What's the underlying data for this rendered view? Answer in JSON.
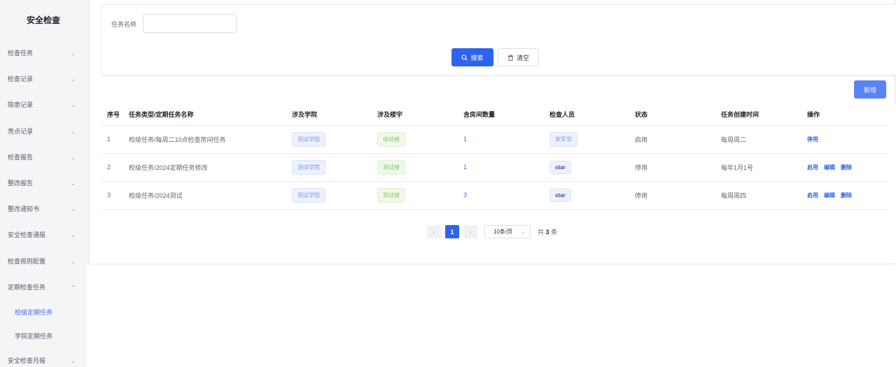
{
  "sidebar": {
    "title": "安全检查",
    "items": [
      {
        "label": "检查任务"
      },
      {
        "label": "检查记录"
      },
      {
        "label": "隐患记录"
      },
      {
        "label": "亮点记录"
      },
      {
        "label": "检查报告"
      },
      {
        "label": "整改报告"
      },
      {
        "label": "整改通知书"
      },
      {
        "label": "安全检查通报"
      },
      {
        "label": "检查规则配置"
      },
      {
        "label": "定期检查任务"
      }
    ],
    "sub_items": [
      {
        "label": "校级定期任务",
        "active": true
      },
      {
        "label": "学院定期任务",
        "active": false
      }
    ],
    "last_item": {
      "label": "安全检查月报"
    }
  },
  "search": {
    "label": "任务名称",
    "value": "",
    "placeholder": "",
    "search_button": "搜索",
    "clear_button": "清空"
  },
  "toolbar": {
    "add_button": "新增"
  },
  "table": {
    "headers": [
      "序号",
      "任务类型/定期任务名称",
      "涉及学院",
      "涉及楼宇",
      "含房间数量",
      "检查人员",
      "状态",
      "任务创建时间",
      "操作"
    ],
    "rows": [
      {
        "index": "1",
        "name": "校级任务/每周二10点检查房间任务",
        "college": "测试学院",
        "building": "体验楼",
        "rooms": "1",
        "inspector": "宋军华",
        "status": "启用",
        "created": "每周周二",
        "ops": [
          "停用"
        ]
      },
      {
        "index": "2",
        "name": "校级任务/2024定期任务修改",
        "college": "测试学院",
        "building": "测试楼",
        "rooms": "1",
        "inspector": "star",
        "status": "停用",
        "created": "每年1月1号",
        "ops": [
          "启用",
          "编辑",
          "删除"
        ]
      },
      {
        "index": "3",
        "name": "校级任务/2024测试",
        "college": "测试学院",
        "building": "测试楼",
        "rooms": "3",
        "inspector": "star",
        "status": "停用",
        "created": "每周周四",
        "ops": [
          "启用",
          "编辑",
          "删除"
        ]
      }
    ]
  },
  "pagination": {
    "current_page": "1",
    "page_size": "10条/页",
    "total_prefix": "共",
    "total": "3",
    "total_suffix": "条"
  },
  "colors": {
    "primary": "#2e62f0",
    "active_menu": "#3c6cf0"
  }
}
